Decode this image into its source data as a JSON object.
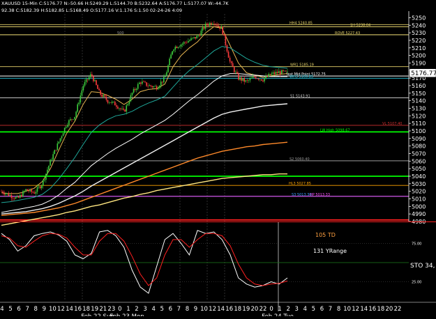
{
  "header": {
    "symbol_info": "XAUUSD 15-Min C:5176.77 N:-50.66 H:5249.29 L:5144.70 B:5232.64 A:5176.77 L:5177.07 W:-44.7K",
    "sub_info": "92.38 C:5182.39 H:5182.85 L:5168.49 O:5177.16 V:1.176 S:1.50 02-24-26 4:09"
  },
  "price_axis": {
    "min": 4980,
    "max": 5255,
    "ticks": [
      4980,
      4990,
      5000,
      5010,
      5020,
      5030,
      5040,
      5050,
      5060,
      5070,
      5080,
      5090,
      5100,
      5110,
      5120,
      5130,
      5140,
      5150,
      5160,
      5170,
      5180,
      5190,
      5200,
      5210,
      5220,
      5230,
      5240,
      5250
    ],
    "current_price": "5176.77",
    "current_value": 5176.77
  },
  "levels": [
    {
      "label": "HH4 5240.85",
      "value": 5240.85,
      "color": "#e6d36a"
    },
    {
      "label": "1H 5238.04",
      "value": 5238.04,
      "color": "#e6d36a"
    },
    {
      "label": "500",
      "value": 5227.4,
      "color": "#9a9a9a"
    },
    {
      "label": "ROVE 5227.43",
      "value": 5227.43,
      "color": "#e6d36a"
    },
    {
      "label": "WR1 5185.19",
      "value": 5185.19,
      "color": "#e6d36a"
    },
    {
      "label": "Yest Mid Point 5172.75",
      "value": 5172.75,
      "color": "#ffffff"
    },
    {
      "label": "WH3 5169.85",
      "value": 5169.85,
      "color": "#22c7e0"
    },
    {
      "label": "S1 5143.91",
      "value": 5143.91,
      "color": "#cccccc"
    },
    {
      "label": "VL 5107.40",
      "value": 5107.4,
      "color": "#d03030"
    },
    {
      "label": "LW High 5098.67",
      "value": 5098.67,
      "color": "#00ff00"
    },
    {
      "label": "S2 5060.40",
      "value": 5060.4,
      "color": "#9a9a9a"
    },
    {
      "label": "",
      "value": 5040,
      "color": "#00ff00"
    },
    {
      "label": "HL3 5027.85",
      "value": 5027.85,
      "color": "#ffa500"
    },
    {
      "label": "S3 5013.36",
      "value": 5013.36,
      "color": "#3aa0ff"
    },
    {
      "label": "HP 5013.33",
      "value": 5013.33,
      "color": "#ff55ff"
    },
    {
      "label": "",
      "value": 4982,
      "color": "#ff2020"
    }
  ],
  "indicator": {
    "td_label": "105 TD",
    "yrange_label": "131 YRange",
    "sto_label": "STO 34,",
    "ticks": [
      "75.00",
      "25.00"
    ],
    "tick_values": [
      75,
      25
    ]
  },
  "time_axis": {
    "hour_labels": [
      "4",
      "5",
      "6",
      "7",
      "8",
      "9",
      "10",
      "12",
      "14",
      "16",
      "18",
      "19",
      "21",
      "23",
      "0",
      "1",
      "2",
      "3",
      "4",
      "5",
      "6",
      "7",
      "8",
      "9",
      "10",
      "12",
      "14",
      "16",
      "18",
      "19",
      "20",
      "22",
      "0",
      "1",
      "2",
      "3",
      "4",
      "5",
      "6",
      "7",
      "8",
      "10",
      "12",
      "14",
      "16",
      "18",
      "20",
      "22"
    ],
    "date_labels": [
      "Feb 22 Sun",
      "Feb 23 Mon",
      "Feb 24 Tue"
    ]
  },
  "chart_data": [
    {
      "type": "candlestick",
      "title": "XAUUSD 15-Min",
      "ylim": [
        4980,
        5255
      ],
      "x_labels": [
        "Feb 22 Sun",
        "Feb 23 Mon",
        "Feb 24 Tue"
      ],
      "price_path": [
        5020,
        5015,
        5010,
        5022,
        5018,
        5030,
        5060,
        5085,
        5110,
        5120,
        5160,
        5175,
        5150,
        5140,
        5135,
        5125,
        5150,
        5165,
        5160,
        5158,
        5170,
        5210,
        5215,
        5220,
        5225,
        5240,
        5245,
        5235,
        5190,
        5170,
        5165,
        5172,
        5168,
        5175,
        5178,
        5176.77
      ],
      "series": [
        {
          "name": "",
          "values": [
            5018,
            5017,
            5017,
            5020,
            5024,
            5033,
            5050,
            5074,
            5097,
            5113,
            5135,
            5152,
            5151,
            5147,
            5142,
            5135,
            5142,
            5152,
            5155,
            5156,
            5162,
            5185,
            5200,
            5210,
            5218,
            5230,
            5238,
            5236,
            5213,
            5190,
            5177,
            5174,
            5171,
            5173,
            5175,
            5176
          ]
        },
        {
          "name": "",
          "values": [
            5005,
            5006,
            5008,
            5010,
            5012,
            5016,
            5024,
            5036,
            5050,
            5065,
            5082,
            5098,
            5108,
            5115,
            5120,
            5122,
            5126,
            5132,
            5137,
            5141,
            5146,
            5158,
            5170,
            5180,
            5188,
            5197,
            5206,
            5212,
            5210,
            5203,
            5196,
            5191,
            5187,
            5185,
            5184,
            5183
          ]
        },
        {
          "name": "",
          "values": [
            4992,
            4994,
            4996,
            4998,
            5000,
            5003,
            5008,
            5015,
            5024,
            5032,
            5043,
            5054,
            5062,
            5070,
            5077,
            5083,
            5089,
            5096,
            5102,
            5108,
            5114,
            5122,
            5131,
            5140,
            5148,
            5157,
            5166,
            5173,
            5176,
            5176,
            5175,
            5174,
            5173,
            5172,
            5172,
            5172
          ]
        },
        {
          "name": "",
          "values": [
            4990,
            4991,
            4992,
            4993,
            4995,
            4997,
            5000,
            5004,
            5009,
            5014,
            5020,
            5027,
            5033,
            5039,
            5045,
            5051,
            5057,
            5063,
            5069,
            5075,
            5081,
            5087,
            5093,
            5099,
            5105,
            5111,
            5117,
            5122,
            5125,
            5127,
            5129,
            5131,
            5133,
            5134,
            5135,
            5136
          ]
        },
        {
          "name": "",
          "values": [
            4988,
            4989,
            4990,
            4991,
            4992,
            4994,
            4996,
            4998,
            5001,
            5004,
            5008,
            5012,
            5016,
            5020,
            5024,
            5028,
            5032,
            5036,
            5040,
            5044,
            5048,
            5052,
            5056,
            5060,
            5064,
            5067,
            5070,
            5073,
            5075,
            5077,
            5079,
            5080,
            5082,
            5083,
            5084,
            5085
          ]
        },
        {
          "name": "",
          "values": [
            4975,
            4977,
            4979,
            4981,
            4983,
            4985,
            4987,
            4989,
            4992,
            4994,
            4997,
            5000,
            5002,
            5005,
            5008,
            5011,
            5013,
            5016,
            5018,
            5021,
            5023,
            5025,
            5027,
            5029,
            5031,
            5033,
            5035,
            5037,
            5038,
            5039,
            5040,
            5041,
            5042,
            5042,
            5043,
            5043
          ]
        }
      ]
    },
    {
      "type": "line",
      "title": "STO 34,",
      "ylim": [
        0,
        100
      ],
      "series": [
        {
          "name": "",
          "values": [
            88,
            80,
            65,
            72,
            85,
            88,
            90,
            86,
            78,
            60,
            55,
            62,
            90,
            92,
            85,
            70,
            40,
            18,
            10,
            45,
            80,
            88,
            75,
            60,
            92,
            88,
            90,
            80,
            60,
            30,
            22,
            18,
            20,
            25,
            22,
            30
          ]
        },
        {
          "name": "",
          "values": [
            85,
            82,
            72,
            70,
            78,
            85,
            88,
            87,
            82,
            70,
            60,
            60,
            78,
            88,
            88,
            78,
            58,
            35,
            20,
            30,
            60,
            80,
            80,
            70,
            80,
            88,
            88,
            85,
            72,
            48,
            30,
            22,
            20,
            22,
            23,
            26
          ]
        }
      ]
    }
  ]
}
